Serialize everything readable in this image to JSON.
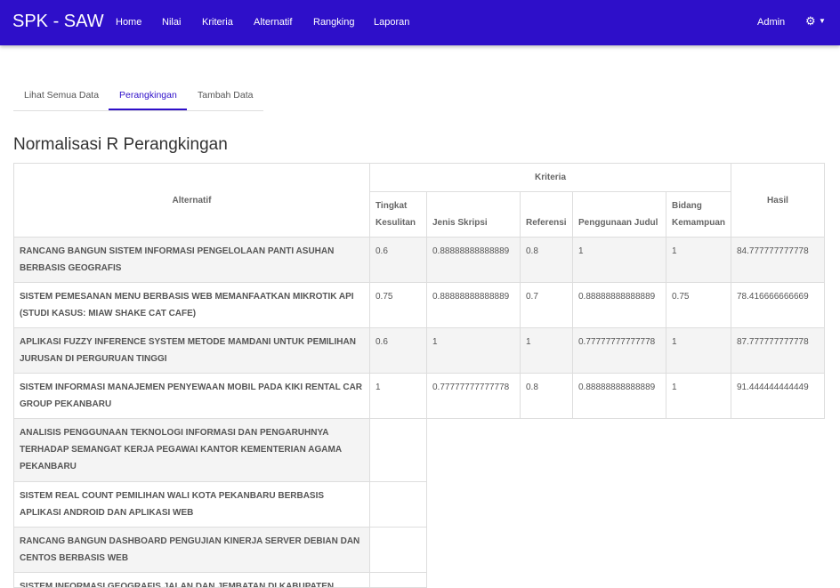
{
  "app": {
    "brand": "SPK - SAW"
  },
  "nav": {
    "links": [
      "Home",
      "Nilai",
      "Kriteria",
      "Alternatif",
      "Rangking",
      "Laporan"
    ],
    "user": "Admin",
    "settings_icon": "gear-icon"
  },
  "tabs": [
    "Lihat Semua Data",
    "Perangkingan",
    "Tambah Data"
  ],
  "page_title": "Normalisasi R Perangkingan",
  "table": {
    "alternatif_header": "Alternatif",
    "kriteria_header": "Kriteria",
    "hasil_header": "Hasil",
    "criteria": [
      "Tingkat Kesulitan",
      "Jenis Skripsi",
      "Referensi",
      "Penggunaan Judul",
      "Bidang Kemampuan"
    ],
    "rows": [
      {
        "name": "RANCANG BANGUN SISTEM INFORMASI PENGELOLAAN PANTI ASUHAN BERBASIS GEOGRAFIS",
        "values": [
          "0.6",
          "0.88888888888889",
          "0.8",
          "1",
          "1"
        ],
        "hasil": "84.777777777778"
      },
      {
        "name": "SISTEM PEMESANAN MENU BERBASIS WEB MEMANFAATKAN MIKROTIK API (STUDI KASUS: MIAW SHAKE CAT CAFE)",
        "values": [
          "0.75",
          "0.88888888888889",
          "0.7",
          "0.88888888888889",
          "0.75"
        ],
        "hasil": "78.416666666669"
      },
      {
        "name": "APLIKASI FUZZY INFERENCE SYSTEM METODE MAMDANI UNTUK PEMILIHAN JURUSAN DI PERGURUAN TINGGI",
        "values": [
          "0.6",
          "1",
          "1",
          "0.77777777777778",
          "1"
        ],
        "hasil": "87.777777777778"
      },
      {
        "name": "SISTEM INFORMASI MANAJEMEN PENYEWAAN MOBIL PADA KIKI RENTAL CAR GROUP PEKANBARU",
        "values": [
          "1",
          "0.77777777777778",
          "0.8",
          "0.88888888888889",
          "1"
        ],
        "hasil": "91.444444444449"
      },
      {
        "name": "ANALISIS PENGGUNAAN TEKNOLOGI INFORMASI DAN PENGARUHNYA TERHADAP SEMANGAT KERJA PEGAWAI KANTOR KEMENTERIAN AGAMA PEKANBARU"
      },
      {
        "name": "SISTEM REAL COUNT PEMILIHAN WALI KOTA PEKANBARU BERBASIS APLIKASI ANDROID DAN APLIKASI WEB"
      },
      {
        "name": "RANCANG BANGUN DASHBOARD PENGUJIAN KINERJA SERVER DEBIAN DAN CENTOS BERBASIS WEB"
      },
      {
        "name": "SISTEM INFORMASI GEOGRAFIS JALAN DAN JEMBATAN DI KABUPATEN"
      }
    ]
  }
}
